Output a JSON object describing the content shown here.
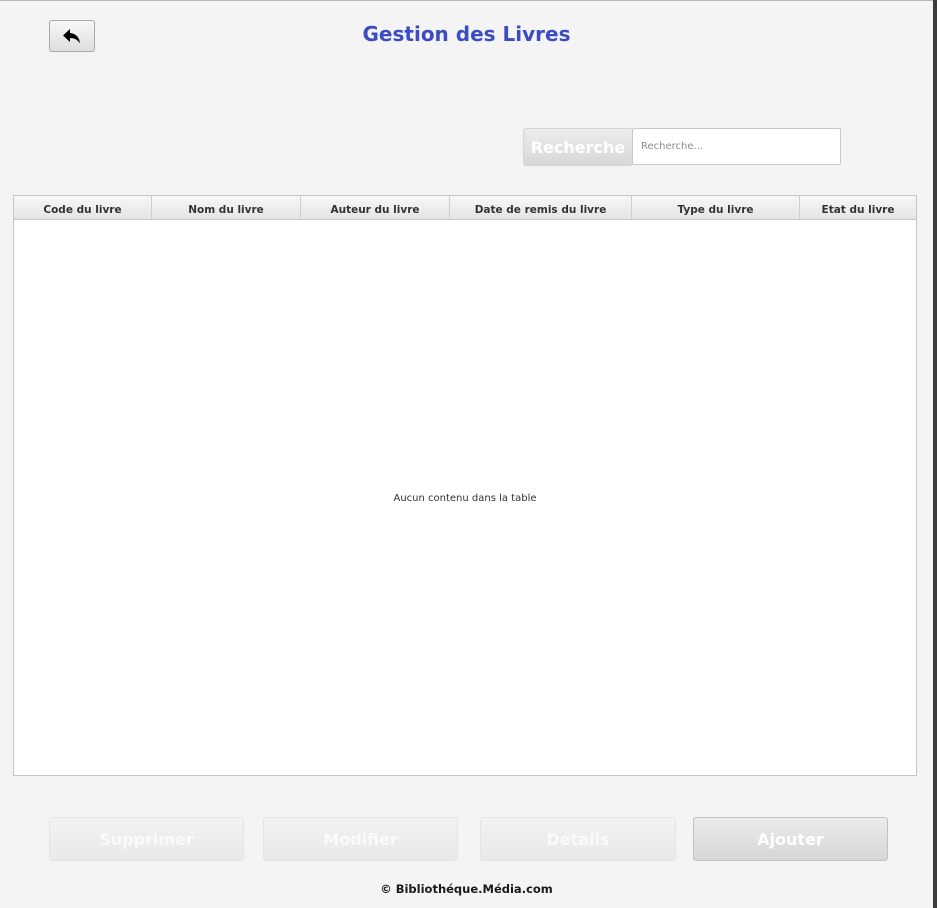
{
  "header": {
    "title": "Gestion des Livres",
    "back_icon": "reply-arrow-icon"
  },
  "search": {
    "button_label": "Recherche",
    "placeholder": "Recherche...",
    "value": ""
  },
  "table": {
    "columns": [
      "Code du livre",
      "Nom du livre",
      "Auteur du livre",
      "Date de remis du livre",
      "Type du livre",
      "Etat du livre"
    ],
    "rows": [],
    "empty_message": "Aucun contenu dans la table"
  },
  "actions": {
    "delete_label": "Supprimer",
    "edit_label": "Modifier",
    "details_label": "Détails",
    "add_label": "Ajouter"
  },
  "footer": {
    "text": "© Bibliothéque.Média.com"
  },
  "colors": {
    "title": "#3b4bc4",
    "background": "#f4f4f4"
  }
}
